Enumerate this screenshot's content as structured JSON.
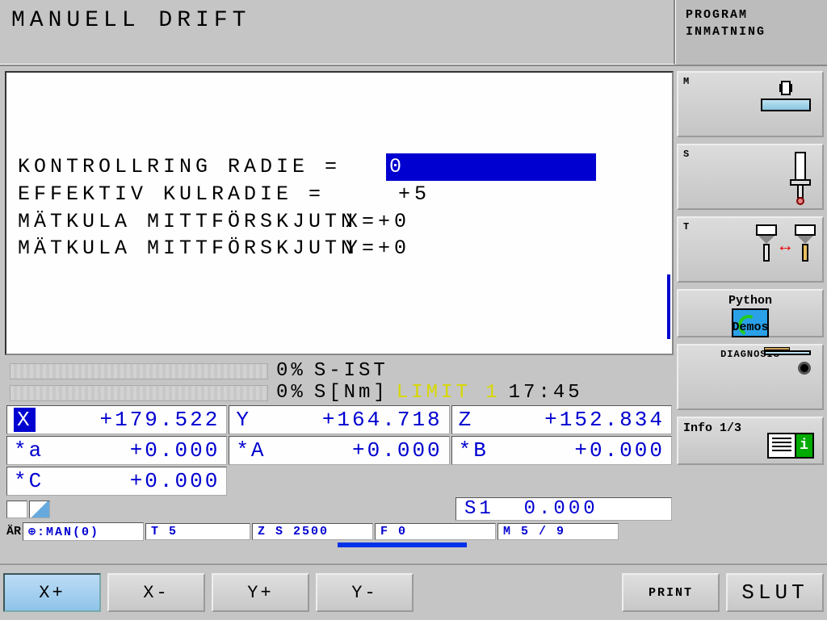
{
  "header": {
    "title": "MANUELL DRIFT",
    "right_line1": "PROGRAM",
    "right_line2": "INMATNING"
  },
  "params": {
    "row1_label": "KONTROLLRING RADIE =",
    "row1_value": "0",
    "row2_label": "EFFEKTIV KULRADIE  =",
    "row2_value": "+5",
    "row3_label": "MÄTKULA MITTFÖRSKJUTN",
    "row3_axis": "X=+0",
    "row4_label": "MÄTKULA MITTFÖRSKJUTN",
    "row4_axis": "Y=+0"
  },
  "status": {
    "sist_pct": "0%",
    "sist_label": "S-IST",
    "snm_pct": "0%",
    "snm_label": "S[Nm]",
    "limit": "LIMIT 1",
    "time": "17:45"
  },
  "dro": {
    "x_axis": "X",
    "x_val": "+179.522",
    "y_axis": "Y",
    "y_val": "+164.718",
    "z_axis": "Z",
    "z_val": "+152.834",
    "a_axis": "*a",
    "a_val": "+0.000",
    "A_axis": "*A",
    "A_val": "+0.000",
    "B_axis": "*B",
    "B_val": "+0.000",
    "C_axis": "*C",
    "C_val": "+0.000"
  },
  "s1": {
    "label": "S1",
    "value": "0.000"
  },
  "statusline": {
    "ar": "ÄR",
    "man": ":MAN(0)",
    "t": "T 5",
    "zs": "Z S 2500",
    "f": "F 0",
    "m": "M 5 / 9"
  },
  "right_softkeys": {
    "m": "M",
    "s": "S",
    "t": "T",
    "python_line1": "Python",
    "python_line2": "Demos",
    "diagnosis": "DIAGNOSIS",
    "info": "Info 1/3",
    "info_i": "i"
  },
  "bottom": {
    "xp": "X+",
    "xm": "X-",
    "yp": "Y+",
    "ym": "Y-",
    "print": "PRINT",
    "slut": "SLUT"
  }
}
